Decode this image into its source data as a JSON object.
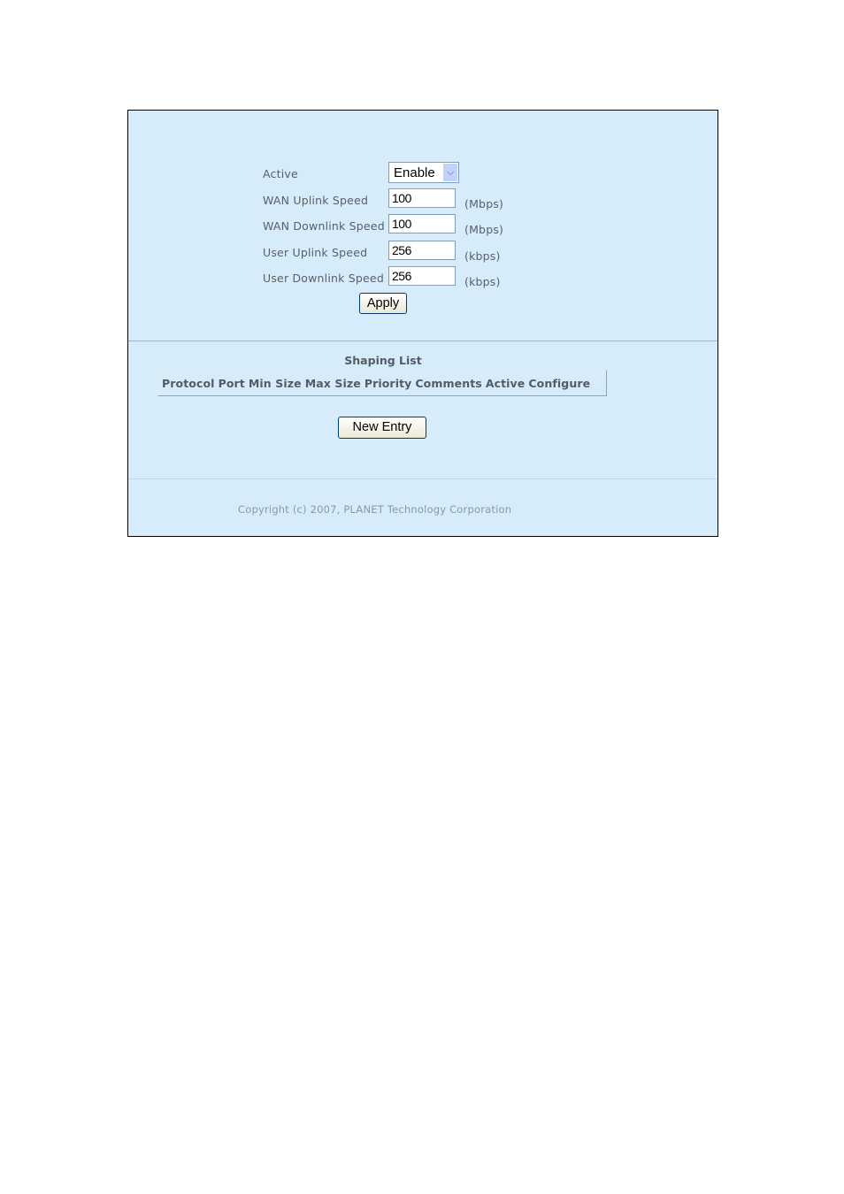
{
  "form": {
    "active": {
      "label": "Active",
      "value": "Enable"
    },
    "wan_uplink": {
      "label": "WAN Uplink Speed",
      "value": "100",
      "unit": "(Mbps)"
    },
    "wan_downlink": {
      "label": "WAN Downlink Speed",
      "value": "100",
      "unit": "(Mbps)"
    },
    "user_uplink": {
      "label": "User Uplink Speed",
      "value": "256",
      "unit": "(kbps)"
    },
    "user_downlink": {
      "label": "User Downlink Speed",
      "value": "256",
      "unit": "(kbps)"
    },
    "apply_label": "Apply"
  },
  "shaping_list": {
    "title": "Shaping List",
    "columns": [
      "Protocol",
      "Port",
      "Min Size",
      "Max Size",
      "Priority",
      "Comments",
      "Active",
      "Configure"
    ],
    "rows": [],
    "new_entry_label": "New Entry"
  },
  "footer": {
    "copyright": "Copyright (c) 2007, PLANET Technology Corporation"
  },
  "icons": {
    "select_arrow": "chevron-down-icon"
  }
}
